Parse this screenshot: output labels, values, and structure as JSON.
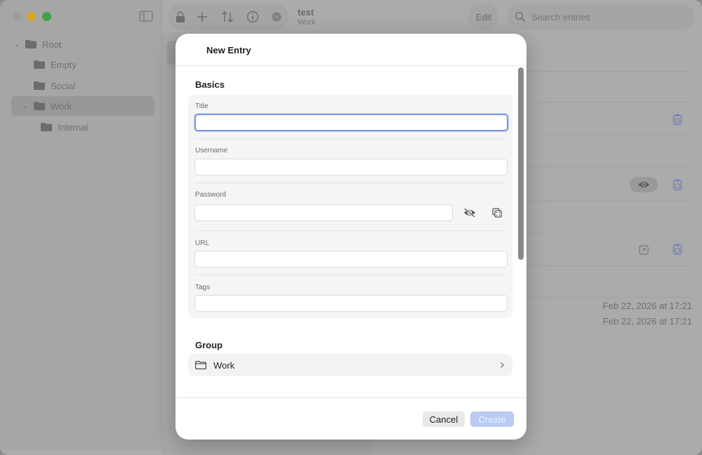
{
  "window": {
    "title": "test",
    "subtitle": "Work"
  },
  "sidebar": {
    "items": [
      {
        "label": "Root",
        "expanded": true,
        "level": 0
      },
      {
        "label": "Empty",
        "level": 1
      },
      {
        "label": "Social",
        "level": 1
      },
      {
        "label": "Work",
        "expanded": true,
        "level": 1,
        "selected": true
      },
      {
        "label": "Internal",
        "level": 2
      }
    ]
  },
  "toolbar": {
    "edit_label": "Edit",
    "search_placeholder": "Search entries"
  },
  "detail": {
    "dates": [
      "Feb 22, 2026 at 17:21",
      "Feb 22, 2026 at 17:21"
    ]
  },
  "modal": {
    "title": "New Entry",
    "basics_title": "Basics",
    "fields": {
      "title_label": "Title",
      "title_value": "",
      "username_label": "Username",
      "username_value": "",
      "password_label": "Password",
      "password_value": "",
      "url_label": "URL",
      "url_value": "",
      "tags_label": "Tags",
      "tags_value": ""
    },
    "group_title": "Group",
    "group_value": "Work",
    "cancel_label": "Cancel",
    "create_label": "Create"
  },
  "colors": {
    "accent": "#7f96dc",
    "create_disabled": "#b8cbf3",
    "traffic_yellow": "#d8a52a",
    "traffic_green": "#3fa244"
  }
}
